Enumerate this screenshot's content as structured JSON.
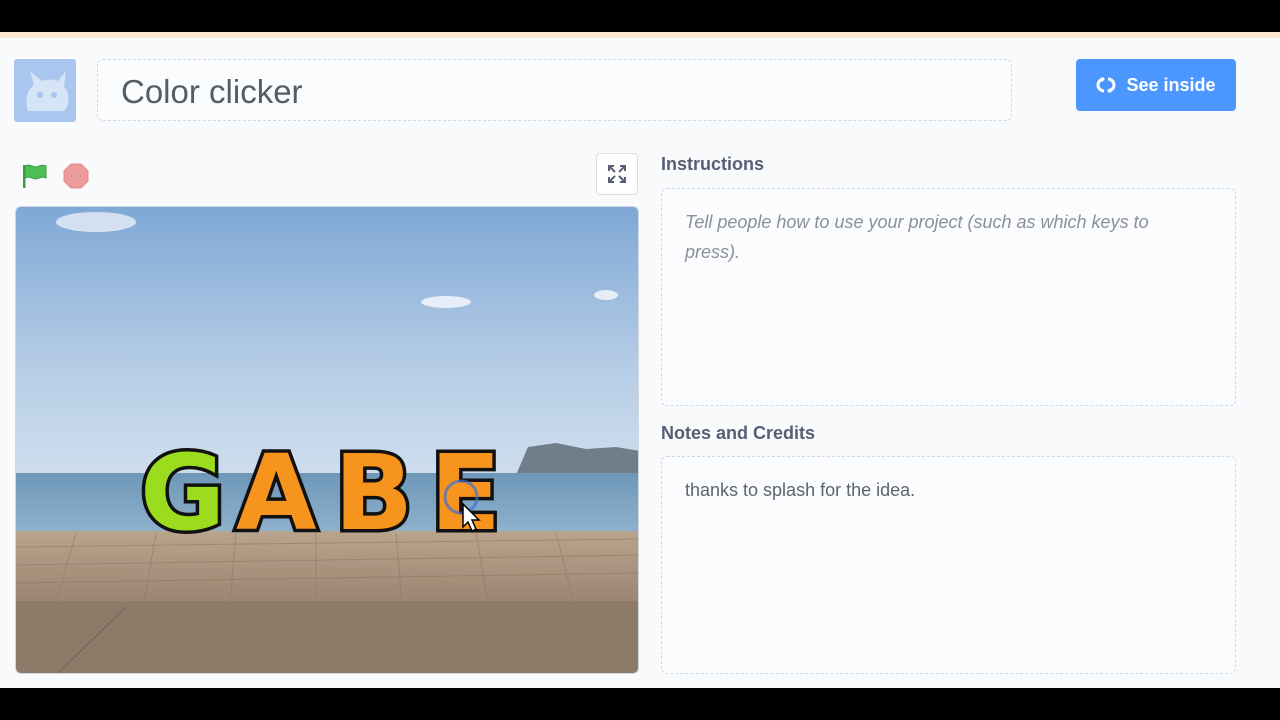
{
  "project": {
    "title": "Color clicker"
  },
  "toolbar": {
    "see_inside_label": "See inside",
    "see_inside_icon": "remix-arrows-icon",
    "flag_icon": "green-flag-icon",
    "stop_icon": "stop-icon",
    "fullscreen_icon": "fullscreen-icon"
  },
  "stage": {
    "sprite_letters": [
      "G",
      "A",
      "B",
      "E"
    ],
    "letter_colors": [
      "#9bdc1e",
      "#f7941d",
      "#f7941d",
      "#f7941d"
    ]
  },
  "instructions": {
    "label": "Instructions",
    "placeholder": "Tell people how to use your project (such as which keys to press)."
  },
  "notes": {
    "label": "Notes and Credits",
    "text": "thanks to splash for the idea."
  },
  "colors": {
    "accent": "#4c97ff",
    "flag_green": "#4cbf56",
    "stop_red": "#ec9c9c"
  }
}
